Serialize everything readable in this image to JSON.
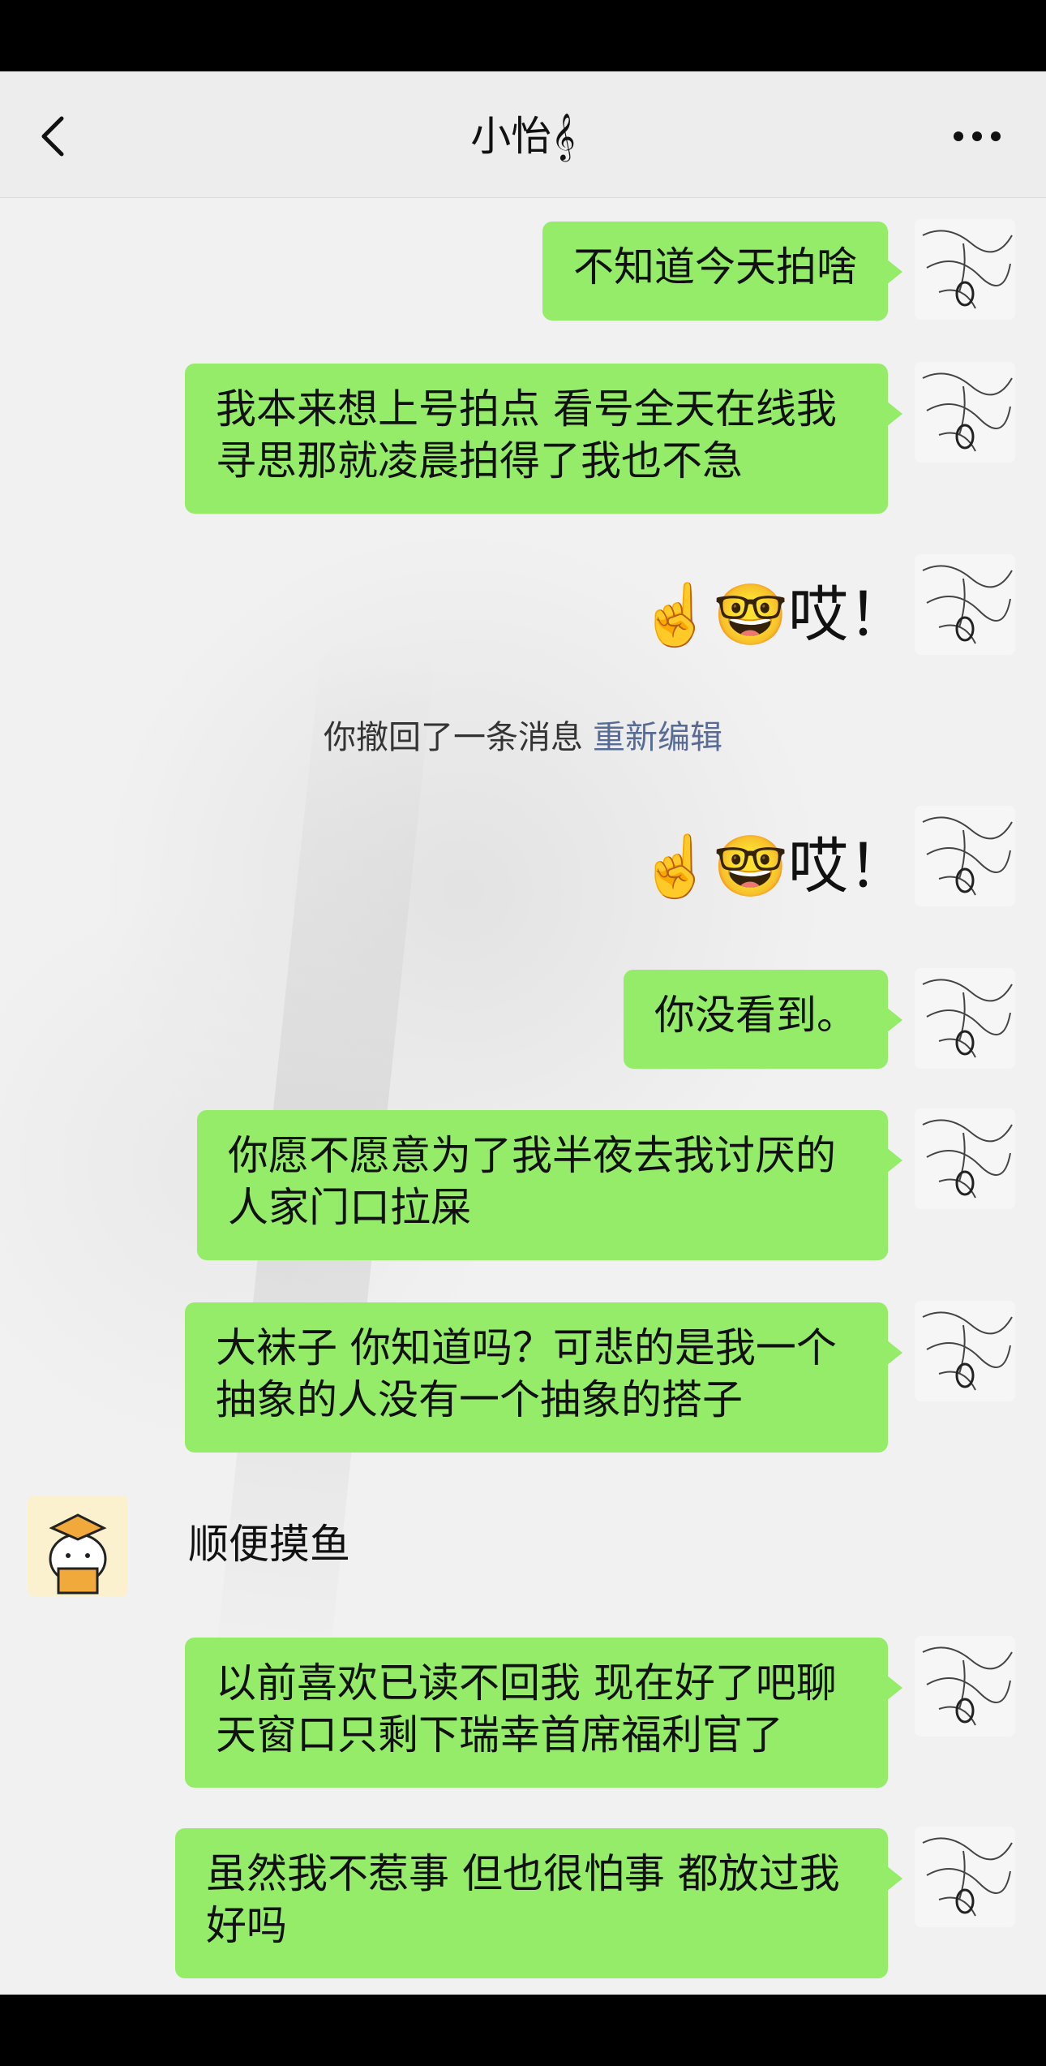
{
  "header": {
    "title": "小怡𝄞"
  },
  "icons": {
    "back": "chevron-left-icon",
    "more": "more-dots-icon"
  },
  "colors": {
    "bubble_self": "#95ec69",
    "link": "#576b95",
    "background": "#f1f1f1"
  },
  "messages": [
    {
      "sender": "me",
      "text": "不知道今天拍啥"
    },
    {
      "sender": "me",
      "text": "我本来想上号拍点 看号全天在线我\n寻思那就凌晨拍得了我也不急"
    },
    {
      "sender": "me",
      "text": "☝️🤓哎！"
    },
    {
      "sender": "me",
      "text": "☝️🤓哎！"
    },
    {
      "sender": "me",
      "text": "你没看到。"
    },
    {
      "sender": "me",
      "text": "你愿不愿意为了我半夜去我讨厌的\n人家门口拉屎"
    },
    {
      "sender": "me",
      "text": "大袜子 你知道吗？可悲的是我一个\n抽象的人没有一个抽象的搭子"
    },
    {
      "sender": "other",
      "text": "顺便摸鱼"
    },
    {
      "sender": "me",
      "text": "以前喜欢已读不回我 现在好了吧聊\n天窗口只剩下瑞幸首席福利官了"
    },
    {
      "sender": "me",
      "text": "虽然我不惹事 但也很怕事 都放过我\n好吗"
    }
  ],
  "system_notice": {
    "text": "你撤回了一条消息",
    "link": "重新编辑"
  }
}
